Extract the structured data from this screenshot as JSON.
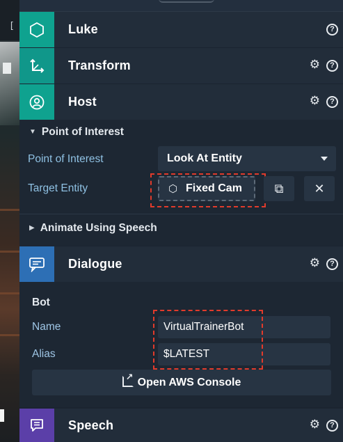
{
  "components": {
    "luke": {
      "title": "Luke"
    },
    "transform": {
      "title": "Transform"
    },
    "host": {
      "title": "Host"
    },
    "dialogue": {
      "title": "Dialogue"
    },
    "speech": {
      "title": "Speech"
    }
  },
  "host_panel": {
    "poi_section": "Point of Interest",
    "poi_label": "Point of Interest",
    "poi_value": "Look At Entity",
    "target_label": "Target Entity",
    "target_value": "Fixed Cam",
    "animate_section": "Animate Using Speech"
  },
  "dialogue_panel": {
    "bot_heading": "Bot",
    "name_label": "Name",
    "name_value": "VirtualTrainerBot",
    "alias_label": "Alias",
    "alias_value": "$LATEST",
    "console_button": "Open AWS Console"
  },
  "icons": {
    "help": "?",
    "gear": "⚙",
    "copy": "⧉",
    "close": "✕",
    "hexagon": "⬡"
  },
  "colors": {
    "teal": "#0fa28f",
    "blue": "#2d6fb5",
    "purple": "#5b3fa8",
    "highlight": "#e23b2b",
    "label": "#8fc1e3"
  }
}
